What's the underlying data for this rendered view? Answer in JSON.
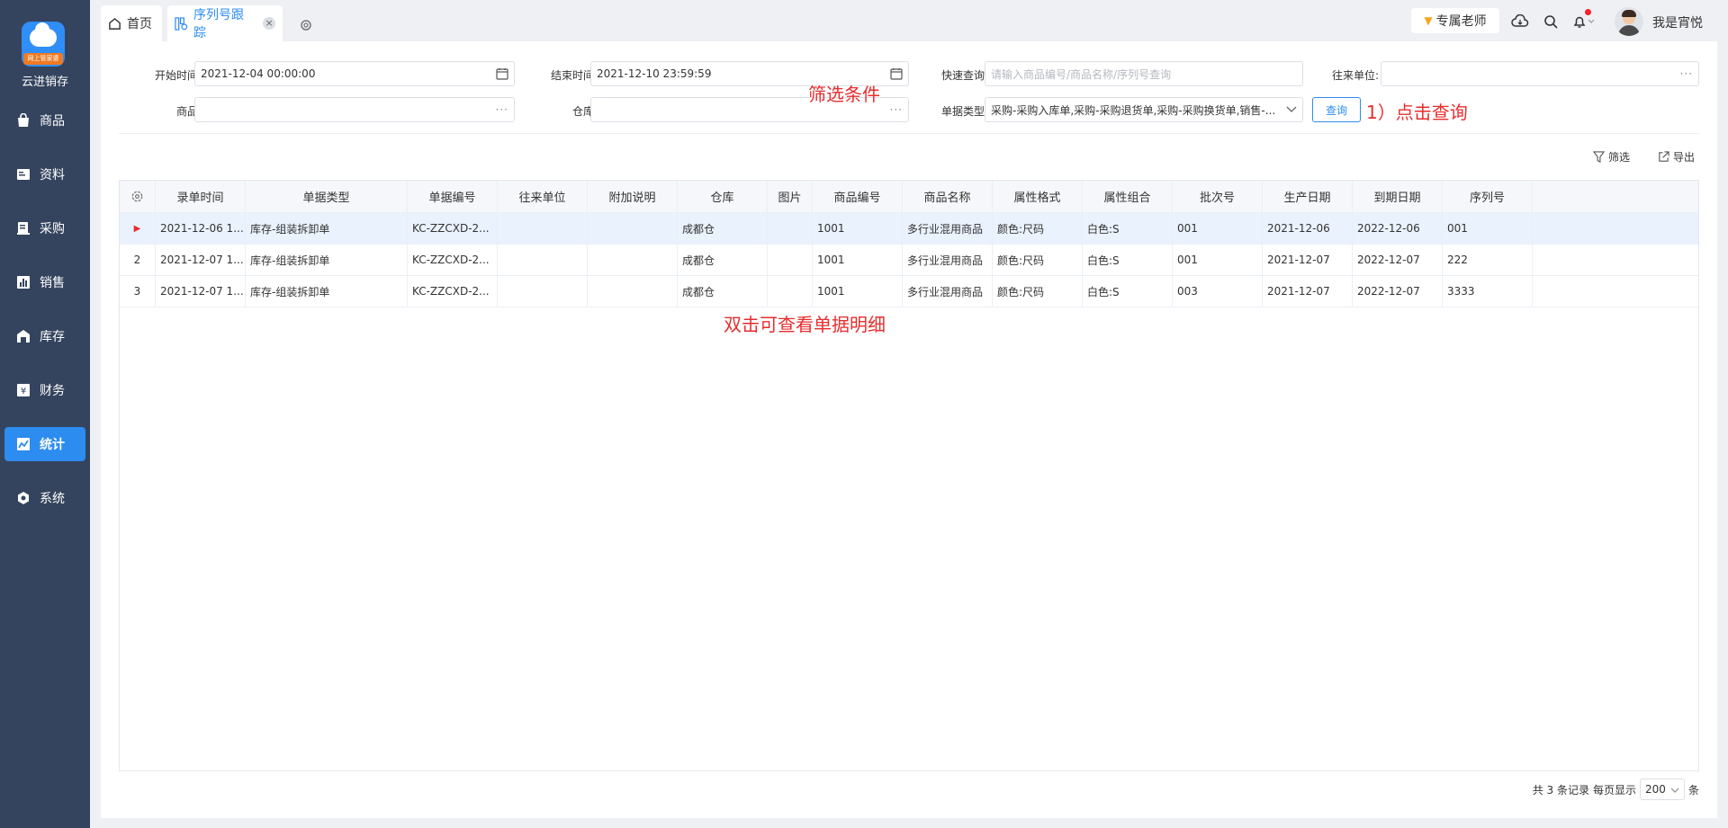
{
  "app": {
    "logo_badge": "网上管家婆",
    "brand": "云进销存"
  },
  "sidebar": {
    "items": [
      {
        "label": "商品",
        "icon": "bag-icon"
      },
      {
        "label": "资料",
        "icon": "document-icon"
      },
      {
        "label": "采购",
        "icon": "purchase-icon"
      },
      {
        "label": "销售",
        "icon": "chart-bar-icon"
      },
      {
        "label": "库存",
        "icon": "warehouse-icon"
      },
      {
        "label": "财务",
        "icon": "yen-icon"
      },
      {
        "label": "统计",
        "icon": "trend-icon"
      },
      {
        "label": "系统",
        "icon": "hexagon-gear-icon"
      }
    ],
    "active_index": 6
  },
  "tabs": {
    "home": "首页",
    "serial": "序列号跟踪",
    "close_glyph": "×"
  },
  "topbar": {
    "teacher": "专属老师",
    "username": "我是宵悦"
  },
  "filters": {
    "start_time_label": "开始时间:",
    "start_time_value": "2021-12-04 00:00:00",
    "end_time_label": "结束时间:",
    "end_time_value": "2021-12-10 23:59:59",
    "quick_label": "快速查询:",
    "quick_placeholder": "请输入商品编号/商品名称/序列号查询",
    "partner_label": "往来单位:",
    "partner_value": "",
    "product_label": "商品:",
    "product_value": "",
    "warehouse_label": "仓库:",
    "warehouse_value": "",
    "doctype_label": "单据类型:",
    "doctype_value": "采购-采购入库单,采购-采购退货单,采购-采购换货单,销售-...",
    "query_button": "查询",
    "ellipsis": "···"
  },
  "annotations": {
    "filter_note": "筛选条件",
    "query_note": "1）点击查询",
    "dblclick_note": "双击可查看单据明细"
  },
  "toolbar": {
    "filter": "筛选",
    "export": "导出"
  },
  "table": {
    "columns": [
      "录单时间",
      "单据类型",
      "单据编号",
      "往来单位",
      "附加说明",
      "仓库",
      "图片",
      "商品编号",
      "商品名称",
      "属性格式",
      "属性组合",
      "批次号",
      "生产日期",
      "到期日期",
      "序列号"
    ],
    "rows": [
      {
        "idx": "▶",
        "cells": [
          "2021-12-06 1...",
          "库存-组装拆卸单",
          "KC-ZZCXD-2...",
          "",
          "",
          "成都仓",
          "",
          "1001",
          "多行业混用商品",
          "颜色:尺码",
          "白色:S",
          "001",
          "2021-12-06",
          "2022-12-06",
          "001"
        ]
      },
      {
        "idx": "2",
        "cells": [
          "2021-12-07 1...",
          "库存-组装拆卸单",
          "KC-ZZCXD-2...",
          "",
          "",
          "成都仓",
          "",
          "1001",
          "多行业混用商品",
          "颜色:尺码",
          "白色:S",
          "001",
          "2021-12-07",
          "2022-12-07",
          "222"
        ]
      },
      {
        "idx": "3",
        "cells": [
          "2021-12-07 1...",
          "库存-组装拆卸单",
          "KC-ZZCXD-2...",
          "",
          "",
          "成都仓",
          "",
          "1001",
          "多行业混用商品",
          "颜色:尺码",
          "白色:S",
          "003",
          "2021-12-07",
          "2022-12-07",
          "3333"
        ]
      }
    ]
  },
  "footer": {
    "total": "共 3 条记录",
    "per_page_label": "每页显示",
    "page_size": "200",
    "unit": "条"
  },
  "colors": {
    "sidebar_bg": "#34445e",
    "accent": "#2d8cf0",
    "annotation": "#e62e2e",
    "selected_row": "#eaf2fd"
  }
}
